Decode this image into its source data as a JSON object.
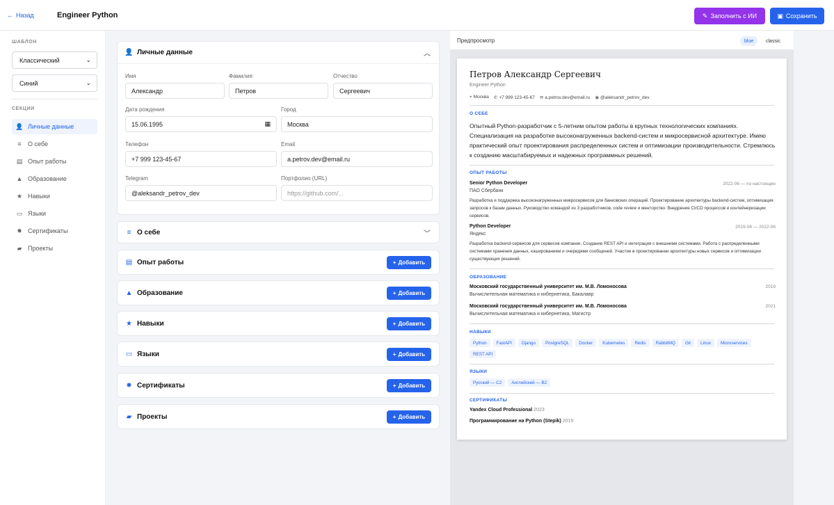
{
  "header": {
    "back_label": "Назад",
    "page_title": "Engineer Python",
    "ai_fill_label": "Заполнить с ИИ",
    "save_label": "Сохранить"
  },
  "sidebar": {
    "template_heading": "ШАБЛОН",
    "template_select": "Классический",
    "color_select": "Синий",
    "sections_heading": "СЕКЦИИ",
    "items": [
      {
        "label": "Личные данные",
        "icon": "user-icon",
        "active": true
      },
      {
        "label": "О себе",
        "icon": "align-left-icon"
      },
      {
        "label": "Опыт работы",
        "icon": "briefcase-icon"
      },
      {
        "label": "Образование",
        "icon": "graduation-cap-icon"
      },
      {
        "label": "Навыки",
        "icon": "star-icon"
      },
      {
        "label": "Языки",
        "icon": "language-icon"
      },
      {
        "label": "Сертификаты",
        "icon": "certificate-icon"
      },
      {
        "label": "Проекты",
        "icon": "folder-icon"
      }
    ]
  },
  "personal": {
    "title": "Личные данные",
    "first_name_label": "Имя",
    "first_name": "Александр",
    "last_name_label": "Фамилия",
    "last_name": "Петров",
    "middle_name_label": "Отчество",
    "middle_name": "Сергеевич",
    "birth_label": "Дата рождения",
    "birth": "15.06.1995",
    "city_label": "Город",
    "city": "Москва",
    "phone_label": "Телефон",
    "phone": "+7 999 123-45-67",
    "email_label": "Email",
    "email": "a.petrov.dev@email.ru",
    "telegram_label": "Telegram",
    "telegram": "@aleksandr_petrov_dev",
    "portfolio_label": "Портфолио (URL)",
    "portfolio_placeholder": "https://github.com/..."
  },
  "sections": {
    "about": "О себе",
    "experience": "Опыт работы",
    "education": "Образование",
    "skills": "Навыки",
    "languages": "Языки",
    "certificates": "Сертификаты",
    "projects": "Проекты",
    "add_label": "Добавить"
  },
  "preview": {
    "title": "Предпросмотр",
    "chip_blue": "blue",
    "chip_classic": "classic",
    "name": "Петров Александр Сергеевич",
    "position": "Engineer Python",
    "contacts": {
      "city": "Москва",
      "phone": "+7 999 123-45-67",
      "email": "a.petrov.dev@email.ru",
      "telegram": "@aleksandr_petrov_dev"
    },
    "about_heading": "О СЕБЕ",
    "about_text": "Опытный Python-разработчик с 5-летним опытом работы в крупных технологических компаниях. Специализация на разработке высоконагруженных backend-систем и микросервисной архитектуре. Имею практический опыт проектирования распределенных систем и оптимизации производительности. Стремлюсь к созданию масштабируемых и надежных программных решений.",
    "experience_heading": "ОПЫТ РАБОТЫ",
    "jobs": [
      {
        "title": "Senior Python Developer",
        "company": "ПАО Сбербанк",
        "dates": "2022-06 — по настоящее",
        "description": "Разработка и поддержка высоконагруженных микросервисов для банковских операций. Проектирование архитектуры backend-систем, оптимизация запросов к базам данных. Руководство командой из 3 разработчиков, code review и менторство. Внедрение CI/CD процессов и контейнеризации сервисов."
      },
      {
        "title": "Python Developer",
        "company": "Яндекс",
        "dates": "2019-06 — 2022-06",
        "description": "Разработка backend-сервисов для сервисов компании. Создание REST API и интеграция с внешними системами. Работа с распределенными системами хранения данных, кэшированием и очередями сообщений. Участие в проектировании архитектуры новых сервисов и оптимизации существующих решений."
      }
    ],
    "education_heading": "ОБРАЗОВАНИЕ",
    "education": [
      {
        "school": "Московский государственный университет им. М.В. Ломоносова",
        "degree": "Вычислительная математика и кибернетика, Бакалавр",
        "year": "2019"
      },
      {
        "school": "Московский государственный университет им. М.В. Ломоносова",
        "degree": "Вычислительная математика и кибернетика, Магистр",
        "year": "2021"
      }
    ],
    "skills_heading": "НАВЫКИ",
    "skills": [
      "Python",
      "FastAPI",
      "Django",
      "PostgreSQL",
      "Docker",
      "Kubernetes",
      "Redis",
      "RabbitMQ",
      "Git",
      "Linux",
      "Microservices",
      "REST API"
    ],
    "languages_heading": "ЯЗЫКИ",
    "languages": [
      "Русский — C2",
      "Английский — B2"
    ],
    "certificates_heading": "СЕРТИФИКАТЫ",
    "certificates": [
      {
        "name": "Yandex Cloud Professional",
        "year": "2023"
      },
      {
        "name": "Программирование на Python (Stepik)",
        "year": "2019"
      }
    ]
  },
  "colors": {
    "accent": "#2563eb",
    "ai_button": "#9333ea"
  }
}
